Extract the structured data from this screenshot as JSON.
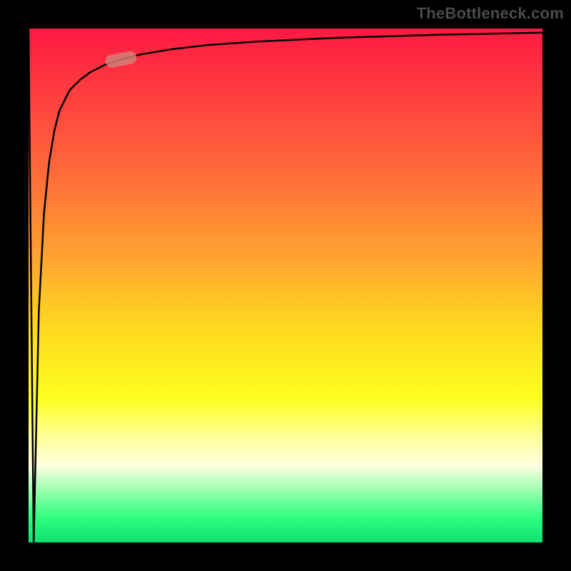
{
  "watermark": "TheBottleneck.com",
  "chart_data": {
    "type": "line",
    "title": "",
    "xlabel": "",
    "ylabel": "",
    "xlim": [
      0,
      100
    ],
    "ylim": [
      0,
      100
    ],
    "series": [
      {
        "name": "curve",
        "x": [
          0,
          1,
          2,
          3,
          4,
          5,
          6,
          8,
          10,
          12,
          15,
          18,
          22,
          28,
          35,
          45,
          60,
          80,
          100
        ],
        "values": [
          100,
          0,
          45,
          64,
          74,
          80,
          84,
          88,
          90,
          91.5,
          93,
          94,
          95,
          96,
          96.8,
          97.5,
          98.2,
          98.8,
          99.2
        ]
      }
    ],
    "marker": {
      "x": 18,
      "y": 94,
      "angle_deg": -10
    },
    "gradient_stops": [
      {
        "pos": 0.0,
        "color": "#ff1a44"
      },
      {
        "pos": 0.08,
        "color": "#ff3040"
      },
      {
        "pos": 0.28,
        "color": "#ff6a3a"
      },
      {
        "pos": 0.45,
        "color": "#ffa530"
      },
      {
        "pos": 0.58,
        "color": "#ffd820"
      },
      {
        "pos": 0.72,
        "color": "#ffff20"
      },
      {
        "pos": 0.8,
        "color": "#ffffa0"
      },
      {
        "pos": 0.85,
        "color": "#ffffe0"
      },
      {
        "pos": 0.95,
        "color": "#30ff80"
      },
      {
        "pos": 1.0,
        "color": "#10e070"
      }
    ]
  }
}
